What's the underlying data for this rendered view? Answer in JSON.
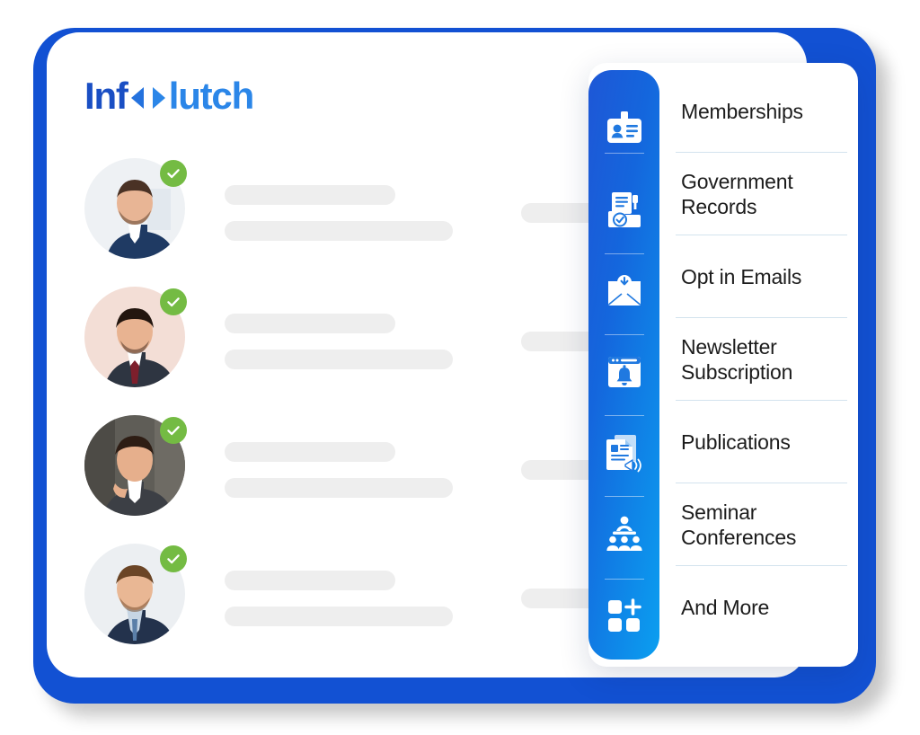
{
  "brand": {
    "logo_part1": "Inf",
    "logo_infinity_icon": "infinity-symbol",
    "logo_part2": "lutch",
    "logo_full_text": "Infoclutch",
    "primary_color": "#1251d3",
    "accent_color": "#0b9ff0",
    "check_color": "#74bb43"
  },
  "records": [
    {
      "verified": true,
      "verified_icon": "check-icon",
      "avatar_icon": "avatar-photo",
      "name_placeholder": "",
      "detail_placeholder": "",
      "side_placeholder": ""
    },
    {
      "verified": true,
      "verified_icon": "check-icon",
      "avatar_icon": "avatar-photo",
      "name_placeholder": "",
      "detail_placeholder": "",
      "side_placeholder": ""
    },
    {
      "verified": true,
      "verified_icon": "check-icon",
      "avatar_icon": "avatar-photo",
      "name_placeholder": "",
      "detail_placeholder": "",
      "side_placeholder": ""
    },
    {
      "verified": true,
      "verified_icon": "check-icon",
      "avatar_icon": "avatar-photo",
      "name_placeholder": "",
      "detail_placeholder": "",
      "side_placeholder": ""
    }
  ],
  "menu": {
    "items": [
      {
        "label": "Memberships",
        "icon": "id-badge-icon"
      },
      {
        "label": "Government Records",
        "icon": "government-records-icon"
      },
      {
        "label": "Opt in Emails",
        "icon": "envelope-download-icon"
      },
      {
        "label": "Newsletter Subscription",
        "icon": "newsletter-bell-icon"
      },
      {
        "label": "Publications",
        "icon": "publications-megaphone-icon"
      },
      {
        "label": "Seminar Conferences",
        "icon": "seminar-audience-icon"
      },
      {
        "label": "And More",
        "icon": "grid-plus-icon"
      }
    ]
  }
}
